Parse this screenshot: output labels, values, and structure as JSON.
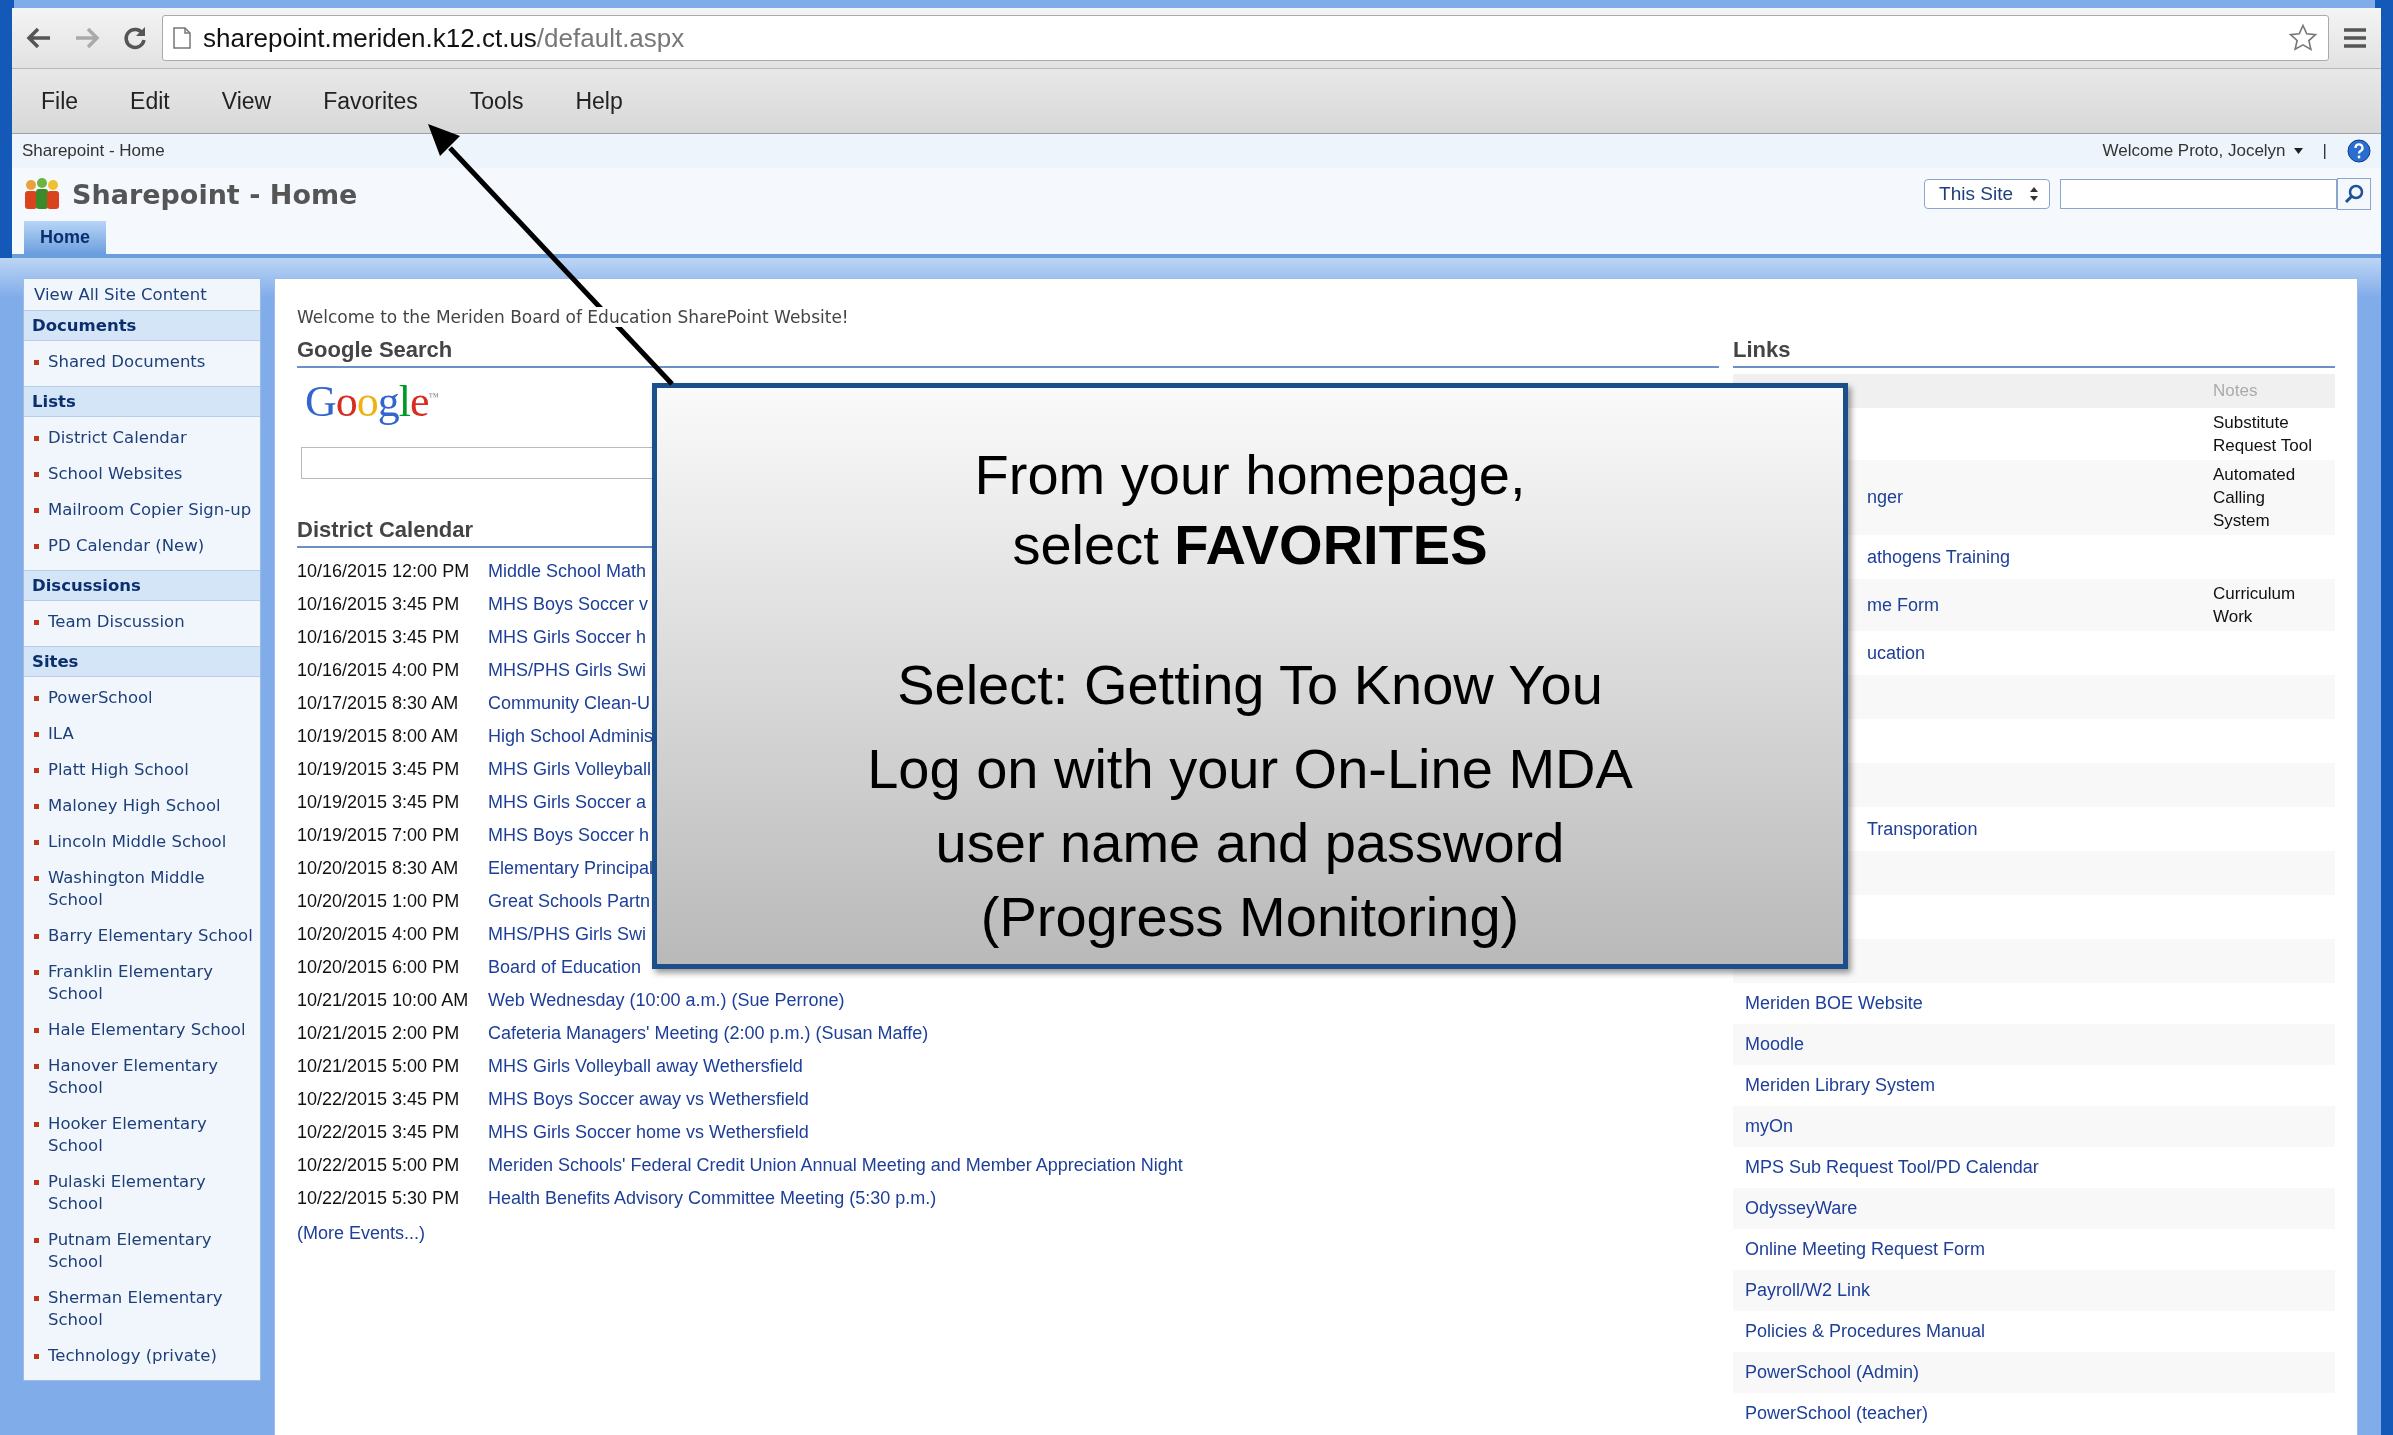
{
  "browser": {
    "url_host": "sharepoint.meriden.k12.ct.us",
    "url_path": "/default.aspx"
  },
  "menu": [
    "File",
    "Edit",
    "View",
    "Favorites",
    "Tools",
    "Help"
  ],
  "site": {
    "breadcrumb": "Sharepoint - Home",
    "welcome": "Welcome Proto, Jocelyn",
    "separator": "|",
    "title": "Sharepoint - Home",
    "scope": "This Site"
  },
  "tabs": [
    {
      "label": "Home",
      "selected": true
    }
  ],
  "sidebar": {
    "top_link": "View All Site Content",
    "sections": [
      {
        "title": "Documents",
        "items": [
          "Shared Documents"
        ]
      },
      {
        "title": "Lists",
        "items": [
          "District Calendar",
          "School Websites",
          "Mailroom Copier Sign-up",
          "PD Calendar (New)"
        ]
      },
      {
        "title": "Discussions",
        "items": [
          "Team Discussion"
        ]
      },
      {
        "title": "Sites",
        "items": [
          "PowerSchool",
          "ILA",
          "Platt High School",
          "Maloney High School",
          "Lincoln Middle School",
          "Washington Middle School",
          "Barry Elementary School",
          "Franklin Elementary School",
          "Hale Elementary School",
          "Hanover Elementary School",
          "Hooker Elementary School",
          "Pulaski Elementary School",
          "Putnam Elementary School",
          "Sherman Elementary School",
          "Technology (private)"
        ]
      }
    ]
  },
  "welcome_message": "Welcome to the Meriden Board of Education SharePoint Website!",
  "google_search": {
    "title": "Google Search",
    "logo": "Google",
    "logo_mark": "™"
  },
  "calendar": {
    "title": "District Calendar",
    "more": "(More Events...)",
    "events": [
      {
        "date": "10/16/2015 12:00 PM",
        "title": "Middle School Math"
      },
      {
        "date": "10/16/2015 3:45 PM",
        "title": "MHS Boys Soccer v"
      },
      {
        "date": "10/16/2015 3:45 PM",
        "title": "MHS Girls Soccer h"
      },
      {
        "date": "10/16/2015 4:00 PM",
        "title": "MHS/PHS Girls Swi"
      },
      {
        "date": "10/17/2015 8:30 AM",
        "title": "Community Clean-U"
      },
      {
        "date": "10/19/2015 8:00 AM",
        "title": "High School Adminis"
      },
      {
        "date": "10/19/2015 3:45 PM",
        "title": "MHS Girls Volleyball"
      },
      {
        "date": "10/19/2015 3:45 PM",
        "title": "MHS Girls Soccer a"
      },
      {
        "date": "10/19/2015 7:00 PM",
        "title": "MHS Boys Soccer h"
      },
      {
        "date": "10/20/2015 8:30 AM",
        "title": "Elementary Principal"
      },
      {
        "date": "10/20/2015 1:00 PM",
        "title": "Great Schools Partn"
      },
      {
        "date": "10/20/2015 4:00 PM",
        "title": "MHS/PHS Girls Swi"
      },
      {
        "date": "10/20/2015 6:00 PM",
        "title": "Board of Education"
      },
      {
        "date": "10/21/2015 10:00 AM",
        "title": "Web Wednesday (10:00 a.m.) (Sue Perrone)"
      },
      {
        "date": "10/21/2015 2:00 PM",
        "title": "Cafeteria Managers' Meeting (2:00 p.m.) (Susan Maffe)"
      },
      {
        "date": "10/21/2015 5:00 PM",
        "title": "MHS Girls Volleyball away Wethersfield"
      },
      {
        "date": "10/22/2015 3:45 PM",
        "title": "MHS Boys Soccer away vs Wethersfield"
      },
      {
        "date": "10/22/2015 3:45 PM",
        "title": "MHS Girls Soccer home vs Wethersfield"
      },
      {
        "date": "10/22/2015 5:00 PM",
        "title": "Meriden Schools' Federal Credit Union Annual Meeting and Member Appreciation Night"
      },
      {
        "date": "10/22/2015 5:30 PM",
        "title": "Health Benefits Advisory Committee Meeting (5:30 p.m.)"
      }
    ]
  },
  "links": {
    "title": "Links",
    "notes_header": "Notes",
    "rows": [
      {
        "kind": "covered",
        "notes": "Substitute Request Tool"
      },
      {
        "kind": "covered",
        "name": "nger",
        "notes": "Automated Calling System"
      },
      {
        "kind": "covered",
        "name": "athogens Training"
      },
      {
        "kind": "covered",
        "name": "me Form",
        "notes": "Curriculum Work"
      },
      {
        "kind": "covered",
        "name": "ucation"
      },
      {
        "kind": "covered"
      },
      {
        "kind": "covered"
      },
      {
        "kind": "covered"
      },
      {
        "kind": "covered",
        "name": "Transporation"
      },
      {
        "kind": "covered"
      },
      {
        "kind": "covered"
      },
      {
        "kind": "covered"
      },
      {
        "kind": "plain",
        "name": "Meriden BOE Website"
      },
      {
        "kind": "plain",
        "name": "Moodle"
      },
      {
        "kind": "plain",
        "name": "Meriden Library System"
      },
      {
        "kind": "plain",
        "name": "myOn"
      },
      {
        "kind": "plain",
        "name": "MPS Sub Request Tool/PD Calendar"
      },
      {
        "kind": "plain",
        "name": "OdysseyWare"
      },
      {
        "kind": "plain",
        "name": "Online Meeting Request Form"
      },
      {
        "kind": "plain",
        "name": "Payroll/W2 Link"
      },
      {
        "kind": "plain",
        "name": "Policies & Procedures Manual"
      },
      {
        "kind": "plain",
        "name": "PowerSchool (Admin)"
      },
      {
        "kind": "plain",
        "name": "PowerSchool (teacher)"
      }
    ]
  },
  "callout": {
    "paragraphs": [
      "From your homepage,\nselect **FAVORITES**",
      "Select: Getting To Know You",
      "Log on with your On-Line MDA\nuser name and password\n(Progress Monitoring)"
    ]
  }
}
